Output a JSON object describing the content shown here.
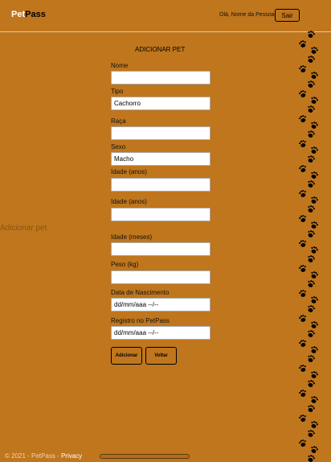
{
  "navbar": {
    "brand_part1": "Pet",
    "brand_part2": "Pass",
    "greeting": "Olá, Nome da Pessoa",
    "logout_label": "Sair"
  },
  "side_label": "Adicionar pet",
  "form": {
    "title": "ADICIONAR PET",
    "fields": [
      {
        "label": "Nome",
        "value": ""
      },
      {
        "label": "Tipo",
        "value": "Cachorro"
      },
      {
        "label": "Raça",
        "value": ""
      },
      {
        "label": "Sexo",
        "value": "Macho"
      },
      {
        "label": "Idade (anos)",
        "value": ""
      },
      {
        "label": "Idade (anos)",
        "value": ""
      },
      {
        "label": "Idade (meses)",
        "value": ""
      },
      {
        "label": "Peso (kg)",
        "value": ""
      },
      {
        "label": "Data de Nascimento",
        "value": "dd/mm/aaa --/--"
      },
      {
        "label": "Registro no PetPass",
        "value": "dd/mm/aaa --/--"
      }
    ],
    "submit_label": "Adicionar",
    "back_label": "Voltar"
  },
  "footer": {
    "copyright": "© 2021 - PetPass - ",
    "privacy_link": "Privacy"
  },
  "colors": {
    "background": "#c0761c",
    "paw": "#000000"
  },
  "decor_icon": "paw-icon"
}
